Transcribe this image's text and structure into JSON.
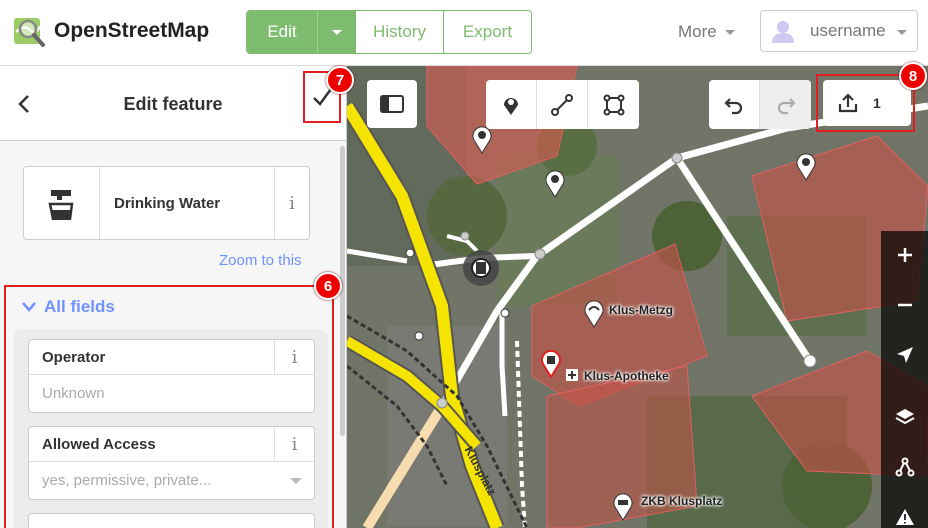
{
  "nav": {
    "brand": "OpenStreetMap",
    "edit_label": "Edit",
    "history_label": "History",
    "export_label": "Export",
    "more_label": "More",
    "username": "username",
    "accent_color": "#7ebc6f"
  },
  "sidebar": {
    "title": "Edit feature",
    "preset_name": "Drinking Water",
    "info_glyph": "i",
    "zoom_link": "Zoom to this",
    "fields_header": "All fields",
    "fields": [
      {
        "label": "Operator",
        "placeholder": "Unknown",
        "info": "i"
      },
      {
        "label": "Allowed Access",
        "placeholder": "yes, permissive, private...",
        "info": "i"
      }
    ]
  },
  "badges": {
    "fields": "6",
    "apply": "7",
    "save": "8",
    "color": "#e02020"
  },
  "map": {
    "save_count": "1",
    "labels": {
      "klus_metzg": "Klus-Metzg",
      "klus_apotheke": "Klus-Apotheke",
      "zkb": "ZKB Klusplatz",
      "street": "Klusplatz"
    }
  }
}
